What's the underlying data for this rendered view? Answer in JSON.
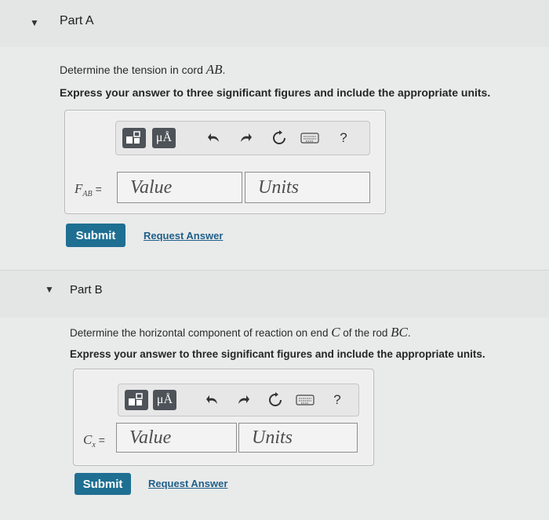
{
  "partA": {
    "title": "Part A",
    "question_prefix": "Determine the tension in cord ",
    "question_var": "AB",
    "question_suffix": ".",
    "instructions": "Express your answer to three significant figures and include the appropriate units.",
    "var_main": "F",
    "var_sub": "AB",
    "equals": "=",
    "value_placeholder": "Value",
    "units_placeholder": "Units",
    "submit_label": "Submit",
    "request_label": "Request Answer"
  },
  "partB": {
    "title": "Part B",
    "question_prefix": "Determine the horizontal component of reaction on end ",
    "question_var1": "C",
    "question_mid": " of the rod ",
    "question_var2": "BC",
    "question_suffix": ".",
    "instructions": "Express your answer to three significant figures and include the appropriate units.",
    "var_main": "C",
    "var_sub": "x",
    "equals": "=",
    "value_placeholder": "Value",
    "units_placeholder": "Units",
    "submit_label": "Submit",
    "request_label": "Request Answer"
  },
  "toolbar": {
    "units_glyph": "μÅ",
    "help_glyph": "?"
  },
  "colors": {
    "submit_bg": "#1e6f92",
    "link": "#1f5f8a",
    "toolbar_button": "#4d5358"
  }
}
